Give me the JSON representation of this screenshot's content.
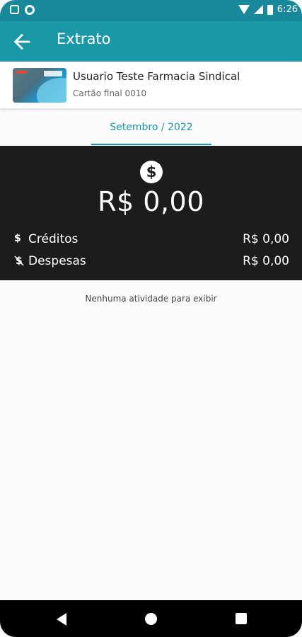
{
  "status_bar": {
    "time": "6:26"
  },
  "app_bar": {
    "title": "Extrato"
  },
  "card": {
    "holder_name": "Usuario Teste Farmacia Sindical",
    "card_label": "Cartão final 0010"
  },
  "period_tab": {
    "label": "Setembro / 2022"
  },
  "summary": {
    "total": "R$  0,00",
    "credits_label": "Créditos",
    "credits_value": "R$  0,00",
    "expenses_label": "Despesas",
    "expenses_value": "R$  0,00"
  },
  "empty_message": "Nenhuma atividade para exibir",
  "colors": {
    "primary": "#1a98a7",
    "status_bar": "#17899a",
    "summary_bg": "#1c1c1c"
  },
  "icons": [
    "back-arrow-icon",
    "dollar-circle-icon",
    "dollar-icon",
    "dollar-off-icon"
  ]
}
